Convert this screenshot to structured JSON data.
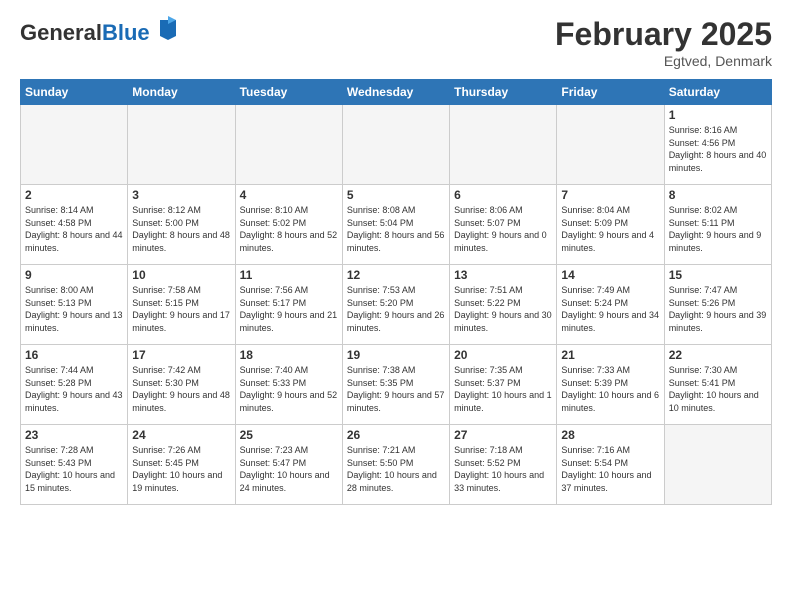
{
  "logo": {
    "general": "General",
    "blue": "Blue"
  },
  "title": "February 2025",
  "subtitle": "Egtved, Denmark",
  "days_of_week": [
    "Sunday",
    "Monday",
    "Tuesday",
    "Wednesday",
    "Thursday",
    "Friday",
    "Saturday"
  ],
  "weeks": [
    [
      {
        "day": "",
        "info": "",
        "empty": true
      },
      {
        "day": "",
        "info": "",
        "empty": true
      },
      {
        "day": "",
        "info": "",
        "empty": true
      },
      {
        "day": "",
        "info": "",
        "empty": true
      },
      {
        "day": "",
        "info": "",
        "empty": true
      },
      {
        "day": "",
        "info": "",
        "empty": true
      },
      {
        "day": "1",
        "info": "Sunrise: 8:16 AM\nSunset: 4:56 PM\nDaylight: 8 hours and 40 minutes."
      }
    ],
    [
      {
        "day": "2",
        "info": "Sunrise: 8:14 AM\nSunset: 4:58 PM\nDaylight: 8 hours and 44 minutes."
      },
      {
        "day": "3",
        "info": "Sunrise: 8:12 AM\nSunset: 5:00 PM\nDaylight: 8 hours and 48 minutes."
      },
      {
        "day": "4",
        "info": "Sunrise: 8:10 AM\nSunset: 5:02 PM\nDaylight: 8 hours and 52 minutes."
      },
      {
        "day": "5",
        "info": "Sunrise: 8:08 AM\nSunset: 5:04 PM\nDaylight: 8 hours and 56 minutes."
      },
      {
        "day": "6",
        "info": "Sunrise: 8:06 AM\nSunset: 5:07 PM\nDaylight: 9 hours and 0 minutes."
      },
      {
        "day": "7",
        "info": "Sunrise: 8:04 AM\nSunset: 5:09 PM\nDaylight: 9 hours and 4 minutes."
      },
      {
        "day": "8",
        "info": "Sunrise: 8:02 AM\nSunset: 5:11 PM\nDaylight: 9 hours and 9 minutes."
      }
    ],
    [
      {
        "day": "9",
        "info": "Sunrise: 8:00 AM\nSunset: 5:13 PM\nDaylight: 9 hours and 13 minutes."
      },
      {
        "day": "10",
        "info": "Sunrise: 7:58 AM\nSunset: 5:15 PM\nDaylight: 9 hours and 17 minutes."
      },
      {
        "day": "11",
        "info": "Sunrise: 7:56 AM\nSunset: 5:17 PM\nDaylight: 9 hours and 21 minutes."
      },
      {
        "day": "12",
        "info": "Sunrise: 7:53 AM\nSunset: 5:20 PM\nDaylight: 9 hours and 26 minutes."
      },
      {
        "day": "13",
        "info": "Sunrise: 7:51 AM\nSunset: 5:22 PM\nDaylight: 9 hours and 30 minutes."
      },
      {
        "day": "14",
        "info": "Sunrise: 7:49 AM\nSunset: 5:24 PM\nDaylight: 9 hours and 34 minutes."
      },
      {
        "day": "15",
        "info": "Sunrise: 7:47 AM\nSunset: 5:26 PM\nDaylight: 9 hours and 39 minutes."
      }
    ],
    [
      {
        "day": "16",
        "info": "Sunrise: 7:44 AM\nSunset: 5:28 PM\nDaylight: 9 hours and 43 minutes."
      },
      {
        "day": "17",
        "info": "Sunrise: 7:42 AM\nSunset: 5:30 PM\nDaylight: 9 hours and 48 minutes."
      },
      {
        "day": "18",
        "info": "Sunrise: 7:40 AM\nSunset: 5:33 PM\nDaylight: 9 hours and 52 minutes."
      },
      {
        "day": "19",
        "info": "Sunrise: 7:38 AM\nSunset: 5:35 PM\nDaylight: 9 hours and 57 minutes."
      },
      {
        "day": "20",
        "info": "Sunrise: 7:35 AM\nSunset: 5:37 PM\nDaylight: 10 hours and 1 minute."
      },
      {
        "day": "21",
        "info": "Sunrise: 7:33 AM\nSunset: 5:39 PM\nDaylight: 10 hours and 6 minutes."
      },
      {
        "day": "22",
        "info": "Sunrise: 7:30 AM\nSunset: 5:41 PM\nDaylight: 10 hours and 10 minutes."
      }
    ],
    [
      {
        "day": "23",
        "info": "Sunrise: 7:28 AM\nSunset: 5:43 PM\nDaylight: 10 hours and 15 minutes."
      },
      {
        "day": "24",
        "info": "Sunrise: 7:26 AM\nSunset: 5:45 PM\nDaylight: 10 hours and 19 minutes."
      },
      {
        "day": "25",
        "info": "Sunrise: 7:23 AM\nSunset: 5:47 PM\nDaylight: 10 hours and 24 minutes."
      },
      {
        "day": "26",
        "info": "Sunrise: 7:21 AM\nSunset: 5:50 PM\nDaylight: 10 hours and 28 minutes."
      },
      {
        "day": "27",
        "info": "Sunrise: 7:18 AM\nSunset: 5:52 PM\nDaylight: 10 hours and 33 minutes."
      },
      {
        "day": "28",
        "info": "Sunrise: 7:16 AM\nSunset: 5:54 PM\nDaylight: 10 hours and 37 minutes."
      },
      {
        "day": "",
        "info": "",
        "empty": true
      }
    ]
  ]
}
